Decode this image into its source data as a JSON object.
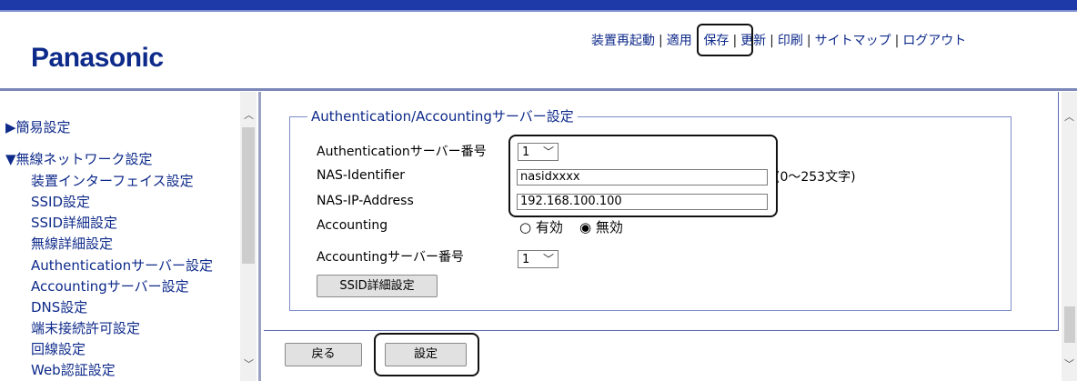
{
  "brand": {
    "logo": "Panasonic"
  },
  "topnav": {
    "restart": "装置再起動",
    "apply": "適用",
    "save": "保存",
    "refresh": "更新",
    "print": "印刷",
    "sitemap": "サイトマップ",
    "logout": "ログアウト",
    "separator": "|"
  },
  "sidebar": {
    "items": [
      "▶簡易設定",
      "▼無線ネットワーク設定",
      "装置インターフェイス設定",
      "SSID設定",
      "SSID詳細設定",
      "無線詳細設定",
      "Authenticationサーバー設定",
      "Accountingサーバー設定",
      "DNS設定",
      "端末接続許可設定",
      "回線設定",
      "Web認証設定"
    ]
  },
  "form": {
    "legend": "Authentication/Accountingサーバー設定",
    "auth_server_label": "Authenticationサーバー番号",
    "auth_server_value": "1",
    "nas_id_label": "NAS-Identifier",
    "nas_id_value": "nasidxxxx",
    "nas_id_hint": "(0〜253文字)",
    "nas_ip_label": "NAS-IP-Address",
    "nas_ip_value": "192.168.100.100",
    "accounting_label": "Accounting",
    "acc_enable": "有効",
    "acc_disable": "無効",
    "acc_selected": "disable",
    "acc_server_label": "Accountingサーバー番号",
    "acc_server_value": "1",
    "ssid_detail_button": "SSID詳細設定"
  },
  "actions": {
    "back": "戻る",
    "submit": "設定"
  }
}
